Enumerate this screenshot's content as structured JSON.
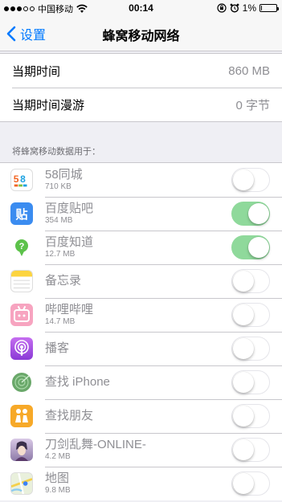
{
  "status_bar": {
    "carrier": "中国移动",
    "time": "00:14",
    "battery": "1%",
    "battery_level": 0.01
  },
  "nav": {
    "back_label": "设置",
    "title": "蜂窝移动网络"
  },
  "usage": [
    {
      "label": "当期时间",
      "value": "860 MB"
    },
    {
      "label": "当期时间漫游",
      "value": "0 字节"
    }
  ],
  "section_header": "将蜂窝移动数据用于：",
  "apps": [
    {
      "name": "58同城",
      "size": "710 KB",
      "enabled": false,
      "icon": "58-tongcheng-icon"
    },
    {
      "name": "百度贴吧",
      "size": "354 MB",
      "enabled": true,
      "icon": "baidu-tieba-icon"
    },
    {
      "name": "百度知道",
      "size": "12.7 MB",
      "enabled": true,
      "icon": "baidu-zhidao-icon"
    },
    {
      "name": "备忘录",
      "size": "",
      "enabled": false,
      "icon": "notes-icon"
    },
    {
      "name": "哔哩哔哩",
      "size": "14.7 MB",
      "enabled": false,
      "icon": "bilibili-icon"
    },
    {
      "name": "播客",
      "size": "",
      "enabled": false,
      "icon": "podcasts-icon"
    },
    {
      "name": "查找 iPhone",
      "size": "",
      "enabled": false,
      "icon": "find-iphone-icon"
    },
    {
      "name": "查找朋友",
      "size": "",
      "enabled": false,
      "icon": "find-friends-icon"
    },
    {
      "name": "刀剑乱舞-ONLINE-",
      "size": "4.2 MB",
      "enabled": false,
      "icon": "touken-ranbu-icon"
    },
    {
      "name": "地图",
      "size": "9.8 MB",
      "enabled": false,
      "icon": "maps-icon"
    }
  ],
  "colors": {
    "accent": "#007aff",
    "toggle_on": "#8fd99b"
  }
}
